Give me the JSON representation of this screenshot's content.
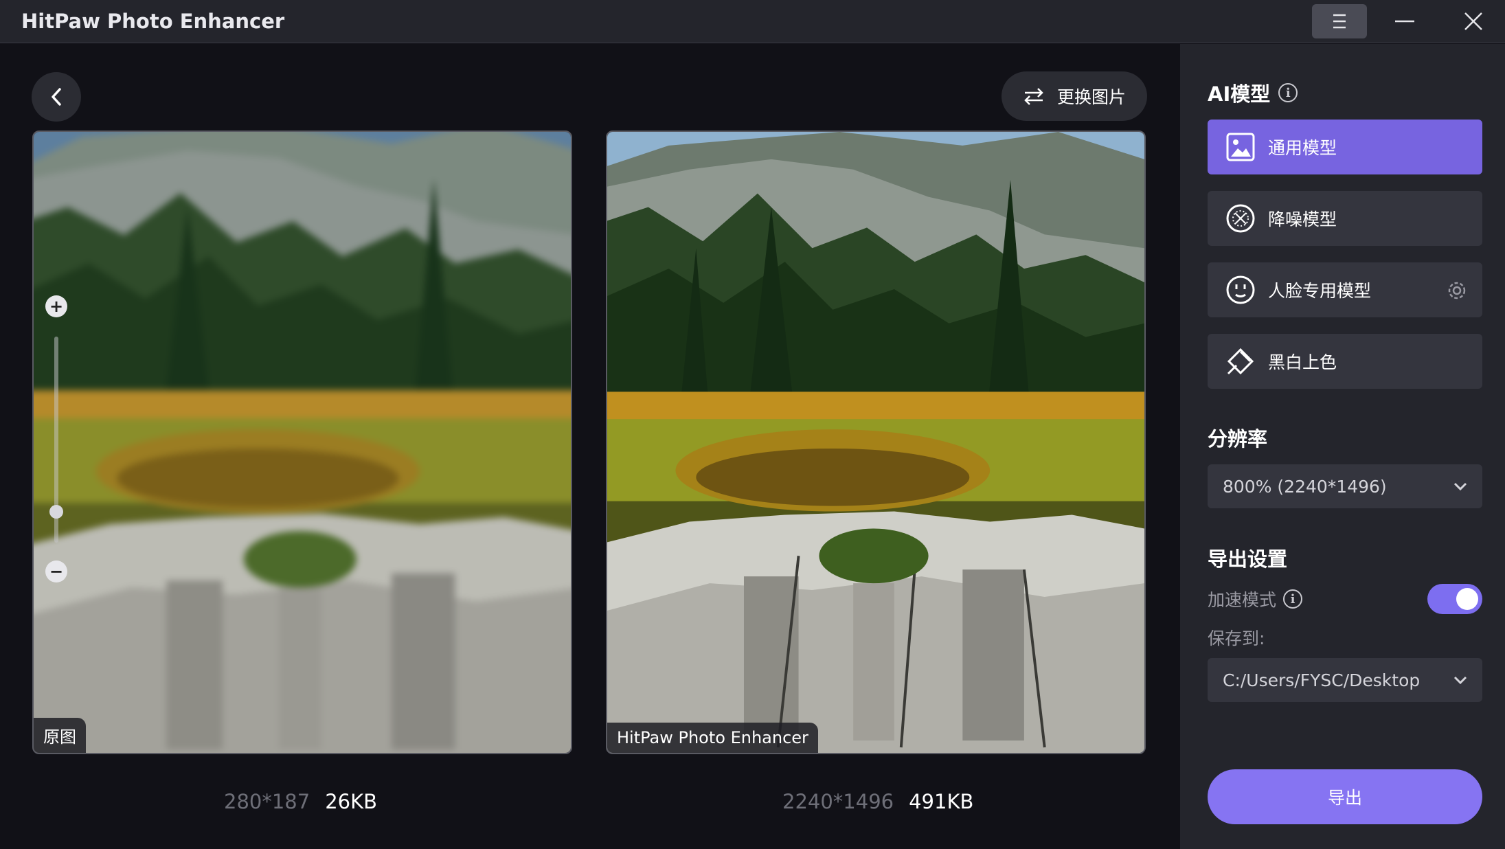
{
  "window": {
    "title": "HitPaw Photo Enhancer"
  },
  "toolbar": {
    "replace_label": "更换图片"
  },
  "preview": {
    "original": {
      "tag": "原图",
      "dimensions": "280*187",
      "size": "26KB"
    },
    "enhanced": {
      "tag": "HitPaw Photo Enhancer",
      "dimensions": "2240*1496",
      "size": "491KB"
    },
    "zoom_level": 0.15
  },
  "panel": {
    "ai_model_title": "AI模型",
    "models": [
      {
        "label": "通用模型",
        "icon": "image-icon",
        "active": true
      },
      {
        "label": "降噪模型",
        "icon": "denoise-icon",
        "active": false
      },
      {
        "label": "人脸专用模型",
        "icon": "face-icon",
        "active": false
      },
      {
        "label": "黑白上色",
        "icon": "colorize-icon",
        "active": false
      }
    ],
    "resolution_title": "分辨率",
    "resolution_value": "800% (2240*1496)",
    "export_title": "导出设置",
    "accel_label": "加速模式",
    "accel_on": true,
    "save_to_label": "保存到:",
    "save_path": "C:/Users/FYSC/Desktop",
    "export_label": "导出"
  },
  "colors": {
    "accent": "#7764e0",
    "export_button": "#8674f2",
    "panel_bg": "#24252c",
    "stage_bg": "#111117"
  }
}
